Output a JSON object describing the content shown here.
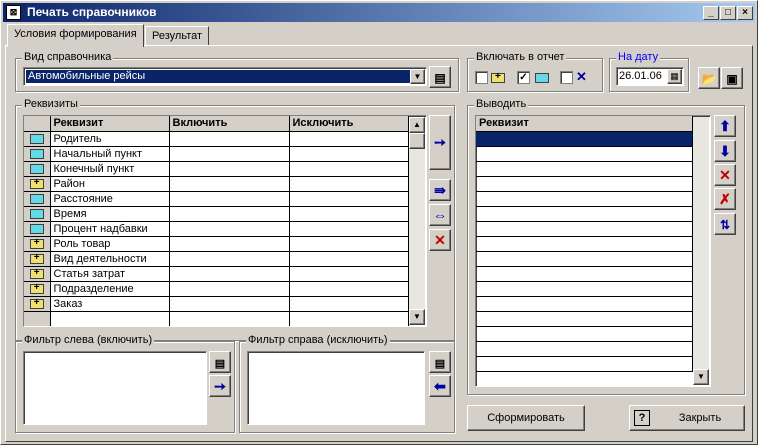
{
  "window": {
    "title": "Печать справочников",
    "min": "_",
    "max": "□",
    "close": "×"
  },
  "tabs": [
    {
      "label": "Условия формирования"
    },
    {
      "label": "Результат"
    }
  ],
  "ref_type": {
    "legend": "Вид справочника",
    "value": "Автомобильные рейсы"
  },
  "include": {
    "legend": "Включать в отчет"
  },
  "date": {
    "legend": "На дату",
    "value": "26.01.06"
  },
  "requisites": {
    "legend": "Реквизиты",
    "headers": [
      "Реквизит",
      "Включить",
      "Исключить"
    ],
    "rows": [
      {
        "name": "Родитель",
        "icon": "cyan"
      },
      {
        "name": "Начальный пункт",
        "icon": "cyan"
      },
      {
        "name": "Конечный пункт",
        "icon": "cyan"
      },
      {
        "name": "Район",
        "icon": "yellow"
      },
      {
        "name": "Расстояние",
        "icon": "cyan"
      },
      {
        "name": "Время",
        "icon": "cyan"
      },
      {
        "name": "Процент надбавки",
        "icon": "cyan"
      },
      {
        "name": "Роль товар",
        "icon": "yellow"
      },
      {
        "name": "Вид деятельности",
        "icon": "yellow"
      },
      {
        "name": "Статья затрат",
        "icon": "yellow"
      },
      {
        "name": "Подразделение",
        "icon": "yellow"
      },
      {
        "name": "Заказ",
        "icon": "yellow"
      }
    ]
  },
  "output": {
    "legend": "Выводить",
    "header": "Реквизит"
  },
  "filter_left": {
    "legend": "Фильтр слева (включить)"
  },
  "filter_right": {
    "legend": "Фильтр справа (исключить)"
  },
  "buttons": {
    "form": "Сформировать",
    "close": "Закрыть",
    "help": "?"
  },
  "colors": {
    "selection": "#0a246a",
    "accent_blue": "#0000a0",
    "red": "#c00000"
  }
}
